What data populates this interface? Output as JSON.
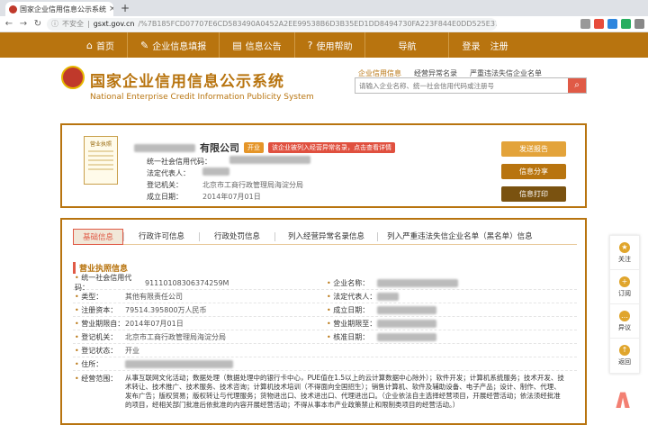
{
  "browser": {
    "tab_title": "国家企业信用信息公示系统",
    "new_tab": "+",
    "close": "×",
    "security_label": "不安全",
    "url_domain": "gsxt.gov.cn",
    "url_path": "/%7B185FCD07707E6CD583490A0452A2EE99538B6D3B35ED1DD8494730FA223F844E0DD525E3717F992088FF46EE08..."
  },
  "nav": {
    "items": [
      "首页",
      "企业信息填报",
      "信息公告",
      "使用帮助",
      "导航"
    ],
    "login": "登录",
    "register": "注册"
  },
  "header": {
    "logo_cn": "国家企业信用信息公示系统",
    "logo_en": "National Enterprise Credit Information Publicity System",
    "links": [
      "企业信用信息",
      "经营异常名录",
      "严重违法失信企业名单"
    ],
    "search_placeholder": "请输入企业名称、统一社会信用代码或注册号"
  },
  "company": {
    "name_suffix": "有限公司",
    "status_badge": "开业",
    "alert_badge": "该企业被列入经营异常名录，点击查看详情",
    "license_label": "营业执照",
    "credit_code_label": "统一社会信用代码：",
    "rep_label": "法定代表人：",
    "authority_label": "登记机关：",
    "authority": "北京市工商行政管理局海淀分局",
    "date_label": "成立日期：",
    "date": "2014年07月01日",
    "buttons": [
      "发送报告",
      "信息分享",
      "信息打印"
    ]
  },
  "tabs": [
    "基础信息",
    "行政许可信息",
    "行政处罚信息",
    "列入经营异常名录信息",
    "列入严重违法失信企业名单（黑名单）信息"
  ],
  "section_title": "营业执照信息",
  "fields": {
    "credit_code_k": "统一社会信用代码：",
    "credit_code_v": "91110108306374259M",
    "name_k": "企业名称：",
    "type_k": "类型：",
    "type_v": "其他有限责任公司",
    "rep_k": "法定代表人：",
    "capital_k": "注册资本：",
    "capital_v": "79514.395800万人民币",
    "est_k": "成立日期：",
    "from_k": "营业期限自：",
    "from_v": "2014年07月01日",
    "to_k": "营业期限至：",
    "authority_k": "登记机关：",
    "authority_v": "北京市工商行政管理局海淀分局",
    "approve_k": "核准日期：",
    "status_k": "登记状态：",
    "status_v": "开业",
    "address_k": "住所：",
    "scope_k": "经营范围：",
    "scope_v": "从事互联网文化活动；数据处理（数据处理中的银行卡中心，PUE值在1.5以上的云计算数据中心除外）；软件开发；计算机系统服务；技术开发、技术转让、技术推广、技术服务、技术咨询；计算机技术培训（不得面向全国招生）；销售计算机、软件及辅助设备、电子产品；设计、制作、代理、发布广告；版权贸易；版权转让与代理服务；货物进出口、技术进出口、代理进出口。（企业依法自主选择经营项目，开展经营活动；依法须经批准的项目，经相关部门批准后依批准的内容开展经营活动；不得从事本市产业政策禁止和限制类项目的经营活动。）"
  },
  "float": [
    "关注",
    "订阅",
    "异议",
    "返回"
  ],
  "colors": {
    "brand": "#b8740f",
    "accent": "#e05a46"
  }
}
